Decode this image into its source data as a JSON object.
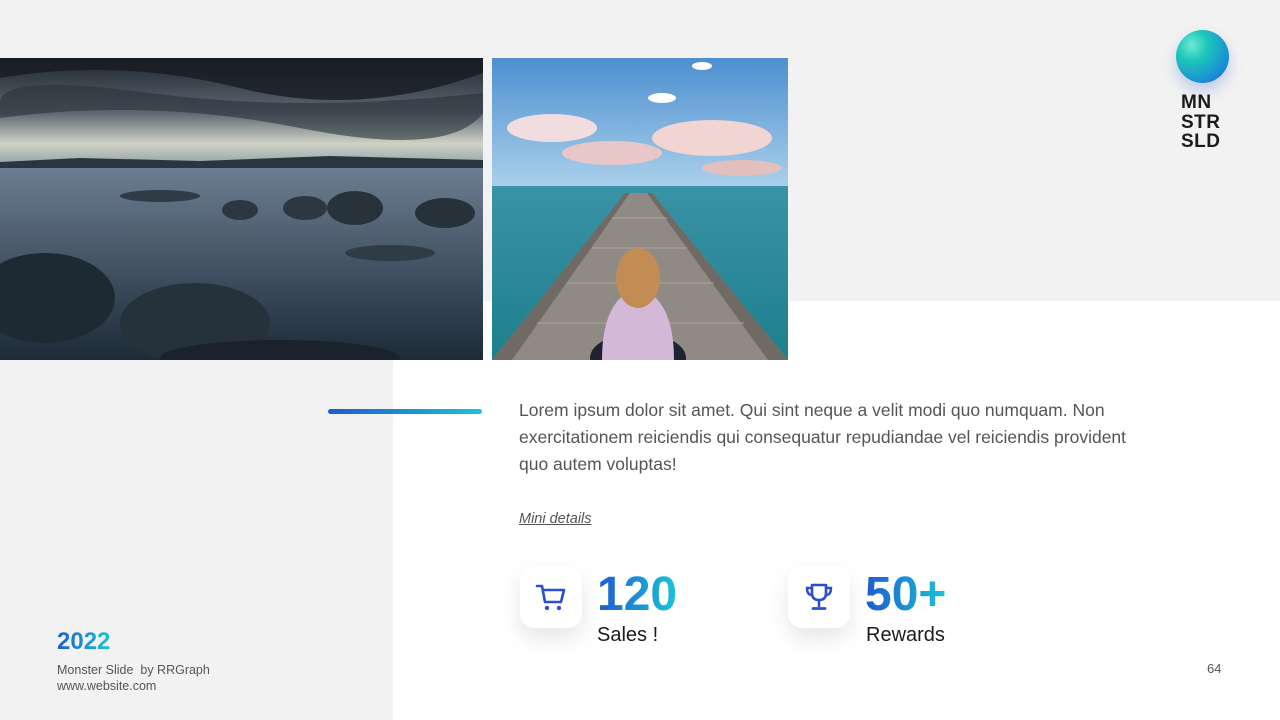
{
  "logo": {
    "lines": [
      "MN",
      "STR",
      "SLD"
    ]
  },
  "content": {
    "paragraph": "Lorem ipsum dolor sit amet. Qui sint neque a velit modi quo numquam. Non exercitationem reiciendis qui consequatur repudiandae vel reiciendis provident quo autem voluptas!",
    "mini_details": "Mini details"
  },
  "stats": [
    {
      "value": "120",
      "label": "Sales !",
      "icon": "shopping-cart-icon"
    },
    {
      "value": "50+",
      "label": "Rewards",
      "icon": "trophy-icon"
    }
  ],
  "footer": {
    "year": "2022",
    "credit_line1": "Monster Slide  by RRGraph",
    "credit_line2": "www.website.com",
    "page_number": "64"
  },
  "colors": {
    "accent_start": "#1e5bd1",
    "accent_end": "#19c4d6",
    "panel_bg": "#f2f2f2"
  }
}
